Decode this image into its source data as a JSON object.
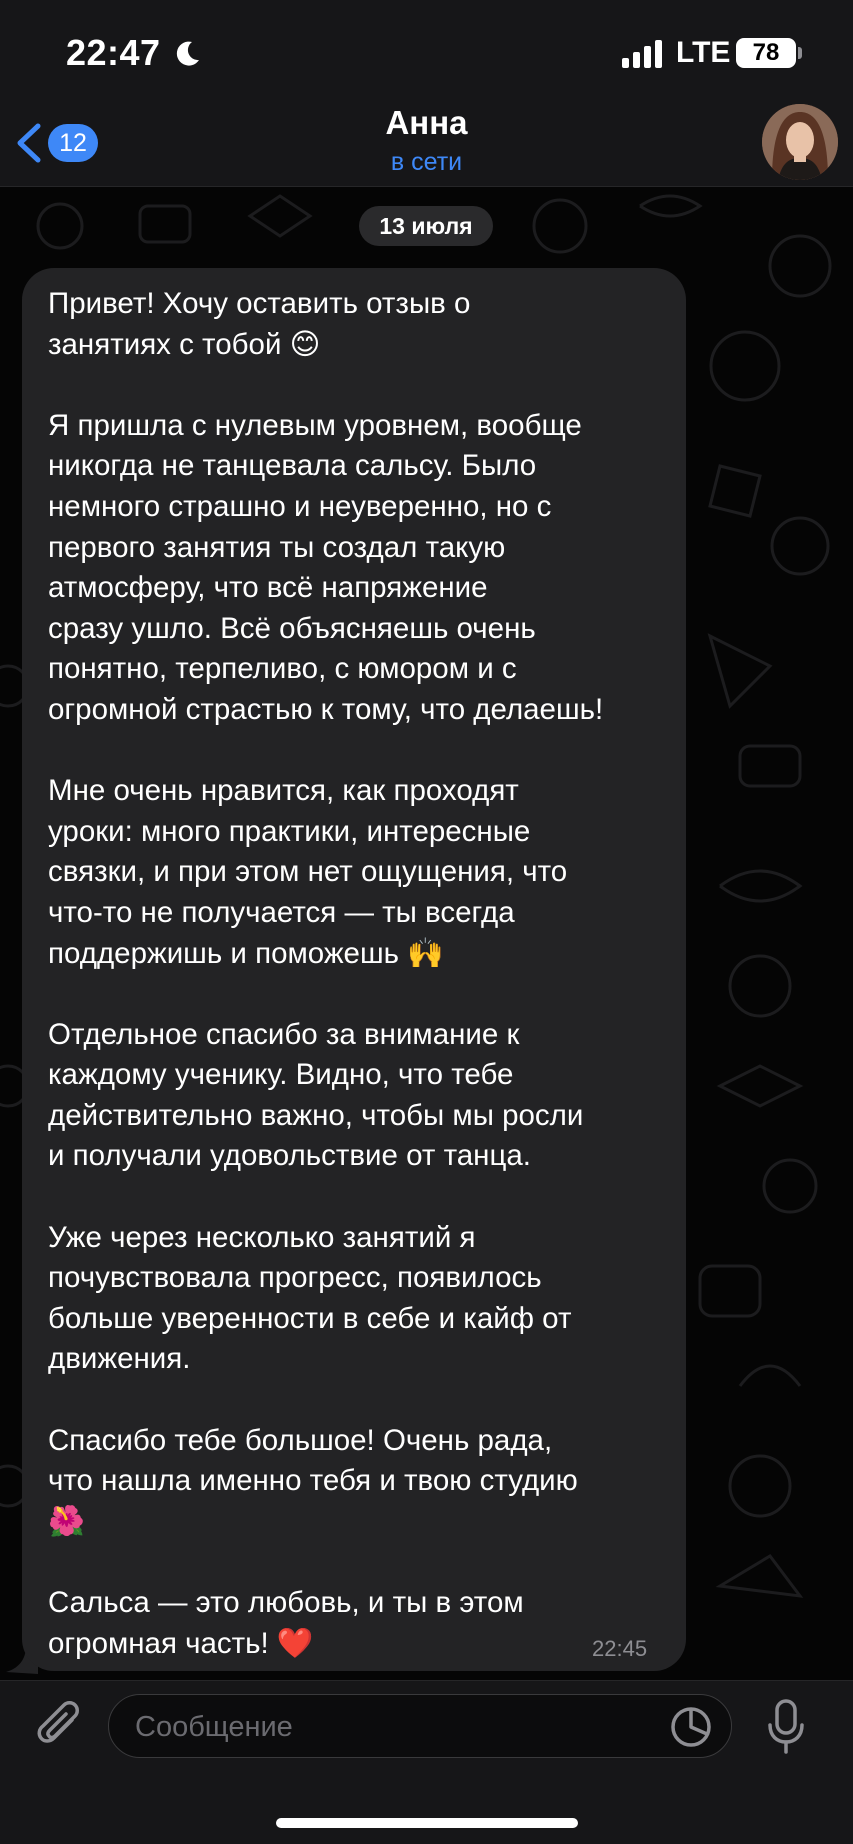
{
  "status_bar": {
    "time": "22:47",
    "network": "LTE",
    "battery": "78"
  },
  "header": {
    "back_badge": "12",
    "contact_name": "Анна",
    "contact_status": "в сети"
  },
  "chat": {
    "date_label": "13 июля",
    "message": {
      "paragraphs": [
        "Привет! Хочу оставить отзыв о\nзанятиях с тобой 😊",
        "Я пришла с нулевым уровнем, вообще\nникогда не танцевала сальсу. Было\nнемного страшно и неуверенно, но с\nпервого занятия ты создал такую\nатмосферу, что всё напряжение\nсразу ушло. Всё объясняешь очень\nпонятно, терпеливо, с юмором и с\nогромной страстью к тому, что делаешь!",
        "Мне очень нравится, как проходят\nуроки: много практики, интересные\nсвязки, и при этом нет ощущения, что\nчто-то не получается — ты всегда\nподдержишь и поможешь 🙌",
        "Отдельное спасибо за внимание к\nкаждому ученику. Видно, что тебе\nдействительно важно, чтобы мы росли\nи получали удовольствие от танца.",
        "Уже через несколько занятий я\nпочувствовала прогресс, появилось\nбольше уверенности в себе и кайф от\nдвижения.",
        "Спасибо тебе большое! Очень рада,\nчто нашла именно тебя и твою студию\n🌺",
        "Сальса — это любовь, и ты в этом\nогромная часть! ❤️"
      ],
      "time": "22:45"
    }
  },
  "input": {
    "placeholder": "Сообщение"
  },
  "colors": {
    "accent": "#3e88f7",
    "bubble": "#232325",
    "bar": "#161618"
  },
  "icons": [
    "moon-icon",
    "signal-icon",
    "back-chevron-icon",
    "attach-icon",
    "sticker-icon",
    "mic-icon"
  ]
}
